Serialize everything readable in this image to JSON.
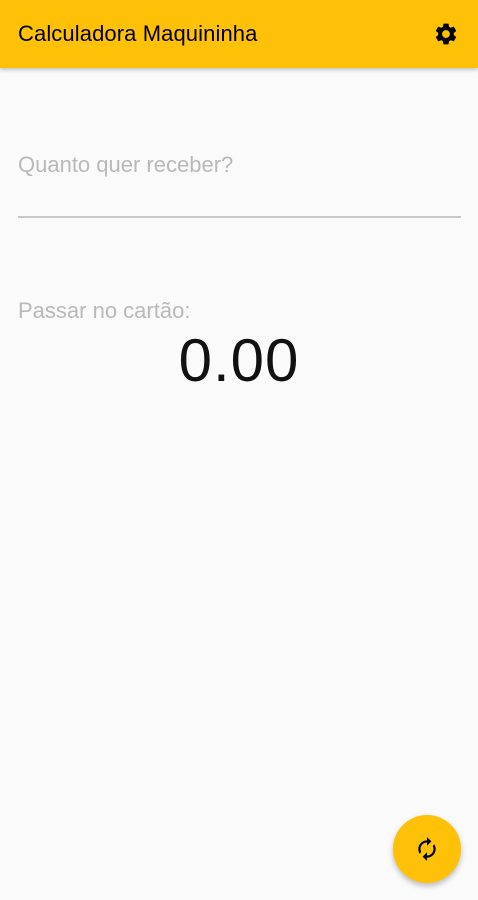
{
  "app": {
    "title": "Calculadora Maquininha",
    "accent_color": "#ffc107"
  },
  "toolbar": {
    "settings_icon": "gear-icon"
  },
  "amount_field": {
    "placeholder": "Quanto quer receber?",
    "value": ""
  },
  "result": {
    "label": "Passar no cartão:",
    "value": "0.00"
  },
  "fab": {
    "icon": "refresh-icon"
  }
}
